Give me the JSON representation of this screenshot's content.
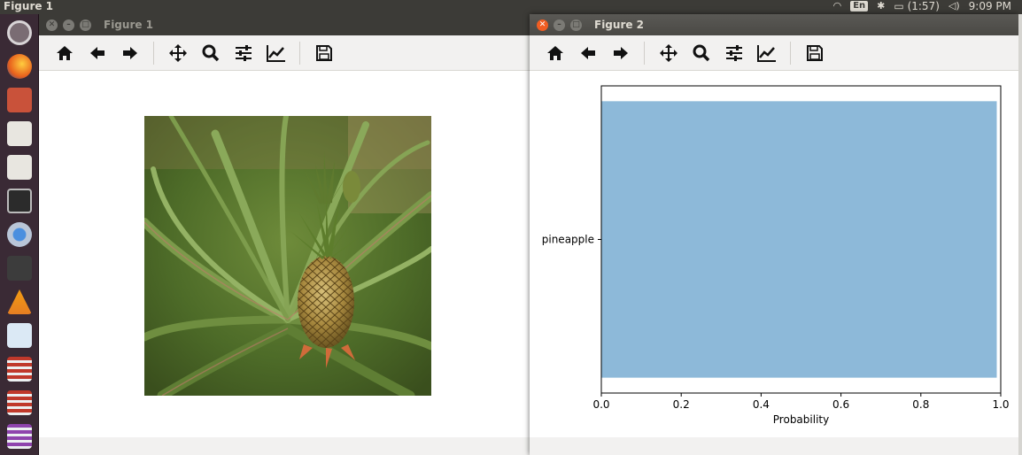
{
  "topbar": {
    "title": "Figure 1",
    "lang": "En",
    "battery": "(1:57)",
    "time": "9:09 PM"
  },
  "window1": {
    "title": "Figure 1",
    "toolbar": [
      "home-icon",
      "back-arrow-icon",
      "forward-arrow-icon",
      "pan-icon",
      "zoom-icon",
      "configure-subplots-icon",
      "edit-axis-icon",
      "save-icon"
    ]
  },
  "window2": {
    "title": "Figure 2",
    "toolbar": [
      "home-icon",
      "back-arrow-icon",
      "forward-arrow-icon",
      "pan-icon",
      "zoom-icon",
      "configure-subplots-icon",
      "edit-axis-icon",
      "save-icon"
    ]
  },
  "colors": {
    "bar": "#8db9d9",
    "accent": "#f15d22"
  },
  "chart_data": {
    "type": "bar",
    "orientation": "horizontal",
    "categories": [
      "pineapple"
    ],
    "values": [
      0.99
    ],
    "xlabel": "Probability",
    "ylabel": "",
    "xlim": [
      0.0,
      1.0
    ],
    "xticks": [
      "0.0",
      "0.2",
      "0.4",
      "0.6",
      "0.8",
      "1.0"
    ],
    "grid": false
  }
}
